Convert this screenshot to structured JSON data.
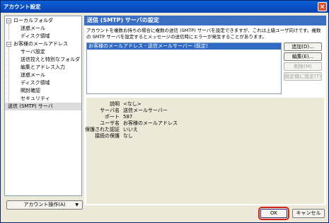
{
  "window": {
    "title": "アカウント設定",
    "close_glyph": "×"
  },
  "tree": {
    "items": [
      {
        "label": "ローカルフォルダ",
        "level": 0,
        "toggle": "−"
      },
      {
        "label": "迷惑メール",
        "level": 1
      },
      {
        "label": "ディスク領域",
        "level": 1
      },
      {
        "label": "お客様のメールアドレス",
        "level": 0,
        "toggle": "−"
      },
      {
        "label": "サーバ設定",
        "level": 1
      },
      {
        "label": "送信控えと特別なフォルダ",
        "level": 1
      },
      {
        "label": "編集とアドレス入力",
        "level": 1
      },
      {
        "label": "迷惑メール",
        "level": 1
      },
      {
        "label": "ディスク領域",
        "level": 1
      },
      {
        "label": "開封確認",
        "level": 1
      },
      {
        "label": "セキュリティ",
        "level": 1
      },
      {
        "label": "送信 (SMTP) サーバ",
        "level": 0,
        "selected": true
      }
    ]
  },
  "account_actions_button": "アカウント操作(A)",
  "panel": {
    "header": "送信 (SMTP) サーバの設定",
    "description": "アカウントを複数お持ちの場合に複数の送信 (SMTP) サーバを設定できますが、これは上級ユーザ向けです。複数の SMTP サーバを設定するとメッセージの送信時にエラーが発生することがあります。",
    "servers": [
      "お客様のメールアドレス - 送信メールサーバー (既定)"
    ],
    "buttons": {
      "add": "追加(D)...",
      "edit": "編集(E)...",
      "delete": "削除(M)",
      "set_default": "既定値に設定(T)"
    },
    "details": [
      {
        "key": "説明",
        "value": "<なし>"
      },
      {
        "key": "サーバ名",
        "value": "送信メールサーバー"
      },
      {
        "key": "ポート",
        "value": "587"
      },
      {
        "key": "ユーザ名",
        "value": "お客様のメールアドレス"
      },
      {
        "key": "保護された認証",
        "value": "いいえ"
      },
      {
        "key": "接続の保護",
        "value": "なし"
      }
    ]
  },
  "footer": {
    "ok": "OK",
    "cancel": "キャンセル"
  }
}
